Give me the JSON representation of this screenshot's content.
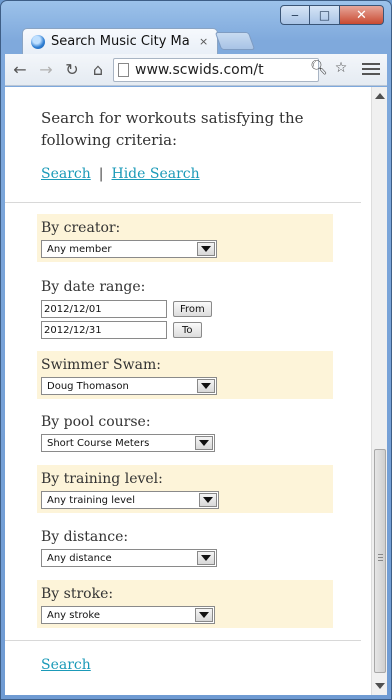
{
  "window": {
    "minimize_icon": "minimize-icon",
    "maximize_icon": "maximize-icon",
    "close_icon": "close-icon"
  },
  "tab": {
    "title": "Search Music City Ma",
    "close_glyph": "×"
  },
  "toolbar": {
    "url": "www.scwids.com/t"
  },
  "page": {
    "intro": "Search for workouts satisfying the following criteria:",
    "search_link": "Search",
    "separator": "|",
    "hide_search_link": "Hide Search",
    "bottom_search_link": "Search"
  },
  "criteria": {
    "creator": {
      "label": "By creator:",
      "value": "Any member"
    },
    "date_range": {
      "label": "By date range:",
      "from_value": "2012/12/01",
      "from_button": "From",
      "to_value": "2012/12/31",
      "to_button": "To"
    },
    "swimmer": {
      "label": "Swimmer Swam:",
      "value": "Doug Thomason"
    },
    "pool_course": {
      "label": "By pool course:",
      "value": "Short Course Meters"
    },
    "training_level": {
      "label": "By training level:",
      "value": "Any training level"
    },
    "distance": {
      "label": "By distance:",
      "value": "Any distance"
    },
    "stroke": {
      "label": "By stroke:",
      "value": "Any stroke"
    }
  },
  "colors": {
    "link": "#1b9ab8",
    "highlight_row": "#fdf4d9"
  }
}
